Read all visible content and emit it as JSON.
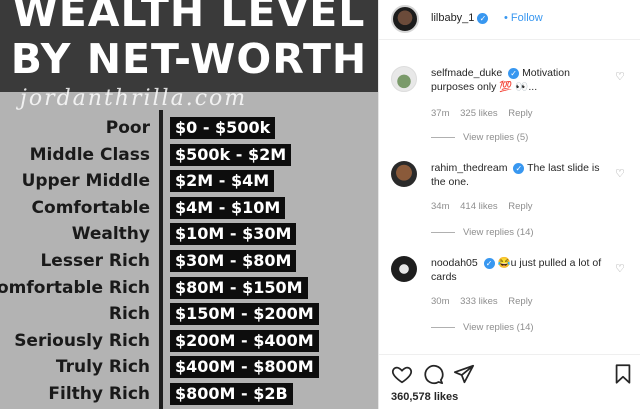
{
  "image": {
    "title_line1": "WEALTH LEVEL",
    "title_line2": "BY NET-WORTH",
    "watermark": "jordanthrilla.com",
    "tiers": [
      {
        "label": "Poor",
        "range": "$0 - $500k"
      },
      {
        "label": "Middle Class",
        "range": "$500k - $2M"
      },
      {
        "label": "Upper Middle",
        "range": "$2M - $4M"
      },
      {
        "label": "Comfortable",
        "range": "$4M - $10M"
      },
      {
        "label": "Wealthy",
        "range": "$10M - $30M"
      },
      {
        "label": "Lesser Rich",
        "range": "$30M - $80M"
      },
      {
        "label": "Comfortable Rich",
        "range": "$80M - $150M"
      },
      {
        "label": "Rich",
        "range": "$150M - $200M"
      },
      {
        "label": "Seriously Rich",
        "range": "$200M - $400M"
      },
      {
        "label": "Truly Rich",
        "range": "$400M - $800M"
      },
      {
        "label": "Filthy Rich",
        "range": "$800M - $2B"
      }
    ]
  },
  "post": {
    "username": "lilbaby_1",
    "follow_label": "Follow",
    "separator": "•",
    "comments": [
      {
        "user": "selfmade_duke",
        "text": "Motivation purposes only 💯 👀...",
        "time": "37m",
        "likes": "325 likes",
        "reply": "Reply",
        "view_replies": "View replies (5)"
      },
      {
        "user": "rahim_thedream",
        "text": "The last slide is the one.",
        "time": "34m",
        "likes": "414 likes",
        "reply": "Reply",
        "view_replies": "View replies (14)"
      },
      {
        "user": "noodah05",
        "text": "😂u just pulled a lot of cards",
        "time": "30m",
        "likes": "333 likes",
        "reply": "Reply",
        "view_replies": "View replies (14)"
      }
    ],
    "likes_total": "360,578 likes"
  },
  "icons": {
    "like": "heart-icon",
    "comment": "comment-icon",
    "share": "paper-plane-icon",
    "save": "bookmark-icon",
    "verified": "verified-badge-icon"
  },
  "colors": {
    "link_blue": "#3897f0",
    "meta_gray": "#8e8e8e",
    "text_dark": "#262626",
    "image_background": "#b3b3b3",
    "image_header": "#3a3a3a",
    "range_box": "#0d0d0d"
  }
}
